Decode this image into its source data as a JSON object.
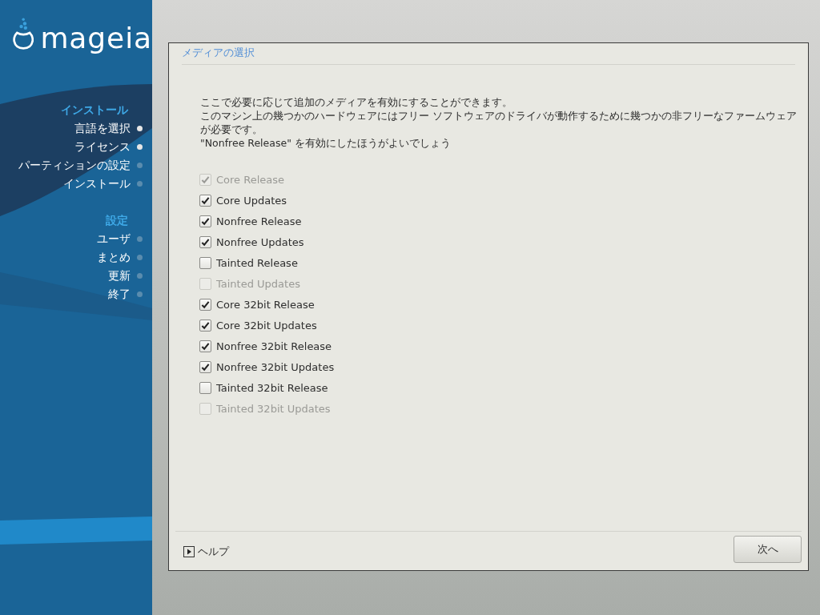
{
  "logo": {
    "text": "mageia"
  },
  "sidebar": {
    "sections": [
      {
        "title": "インストール",
        "items": [
          {
            "label": "言語を選択",
            "done": true
          },
          {
            "label": "ライセンス",
            "done": true
          },
          {
            "label": "パーティションの設定",
            "done": false
          },
          {
            "label": "インストール",
            "done": false
          }
        ]
      },
      {
        "title": "設定",
        "items": [
          {
            "label": "ユーザ",
            "done": false
          },
          {
            "label": "まとめ",
            "done": false
          },
          {
            "label": "更新",
            "done": false
          },
          {
            "label": "終了",
            "done": false
          }
        ]
      }
    ]
  },
  "dialog": {
    "title": "メディアの選択",
    "description": [
      "ここで必要に応じて追加のメディアを有効にすることができます。",
      "このマシン上の幾つかのハードウェアにはフリー ソフトウェアのドライバが動作するために幾つかの非フリーなファームウェアが必要です。",
      "\"Nonfree Release\" を有効にしたほうがよいでしょう"
    ],
    "media": [
      {
        "label": "Core Release",
        "checked": true,
        "disabled": true
      },
      {
        "label": "Core Updates",
        "checked": true,
        "disabled": false
      },
      {
        "label": "Nonfree Release",
        "checked": true,
        "disabled": false
      },
      {
        "label": "Nonfree Updates",
        "checked": true,
        "disabled": false
      },
      {
        "label": "Tainted Release",
        "checked": false,
        "disabled": false
      },
      {
        "label": "Tainted Updates",
        "checked": false,
        "disabled": true
      },
      {
        "label": "Core 32bit Release",
        "checked": true,
        "disabled": false
      },
      {
        "label": "Core 32bit Updates",
        "checked": true,
        "disabled": false
      },
      {
        "label": "Nonfree 32bit Release",
        "checked": true,
        "disabled": false
      },
      {
        "label": "Nonfree 32bit Updates",
        "checked": true,
        "disabled": false
      },
      {
        "label": "Tainted 32bit Release",
        "checked": false,
        "disabled": false
      },
      {
        "label": "Tainted 32bit Updates",
        "checked": false,
        "disabled": true
      }
    ],
    "help": "ヘルプ",
    "next_button": "次へ"
  }
}
